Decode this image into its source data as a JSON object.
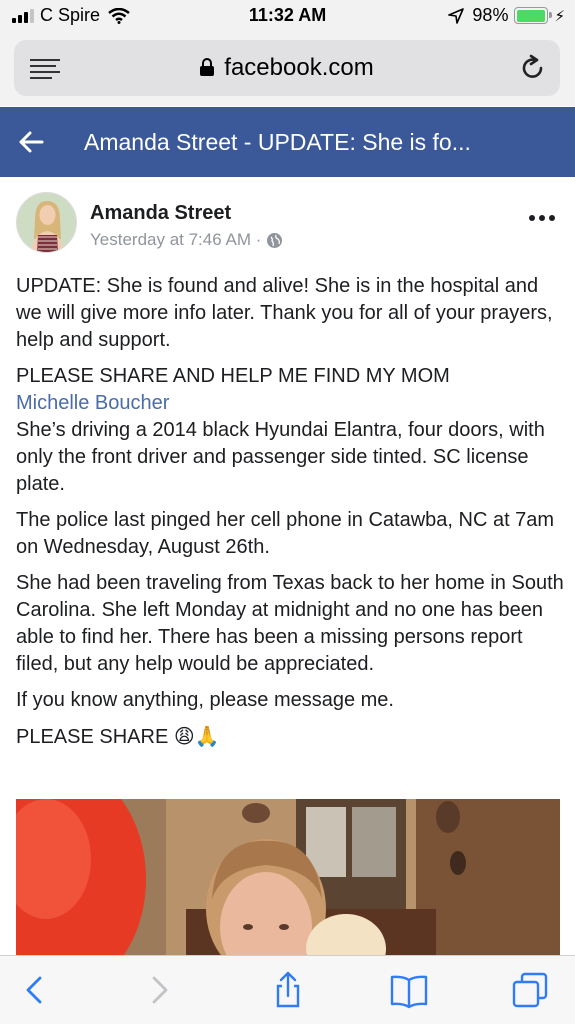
{
  "status_bar": {
    "carrier": "C Spire",
    "time": "11:32 AM",
    "battery": "98%",
    "icons": [
      "signal-icon",
      "wifi-icon",
      "location-icon",
      "battery-icon",
      "charging-icon"
    ]
  },
  "browser": {
    "url": "facebook.com",
    "icons": [
      "reader-icon",
      "lock-icon",
      "reload-icon"
    ]
  },
  "header": {
    "title": "Amanda Street - UPDATE: She is fo...",
    "background": "#3b5998"
  },
  "post": {
    "author": "Amanda Street",
    "timestamp": "Yesterday at 7:46 AM ·",
    "paragraphs": {
      "update": "UPDATE: She is found and alive! She is in the hospital and we will give more info later. Thank you for all of your prayers, help and support.",
      "share_line": "PLEASE SHARE AND HELP ME FIND MY MOM",
      "mention": "Michelle Boucher",
      "car": "She’s driving a 2014 black Hyundai Elantra, four doors, with only the front driver and passenger side tinted. SC license plate.",
      "police": "The police last pinged her cell phone in Catawba, NC at 7am on Wednesday, August 26th.",
      "travel": "She had been traveling from Texas back to her home in South Carolina. She left Monday at midnight and no one has been able to find her. There has been a missing persons report filed, but any help would be appreciated.",
      "contact": "If you know anything, please message me.",
      "closing": "PLEASE SHARE",
      "closing_emoji": "😩🙏"
    },
    "link_color": "#4b6ca9"
  },
  "toolbar": {
    "icons": [
      "back-icon",
      "forward-icon",
      "share-icon",
      "bookmarks-icon",
      "tabs-icon"
    ],
    "accent": "#2f7cf6"
  }
}
